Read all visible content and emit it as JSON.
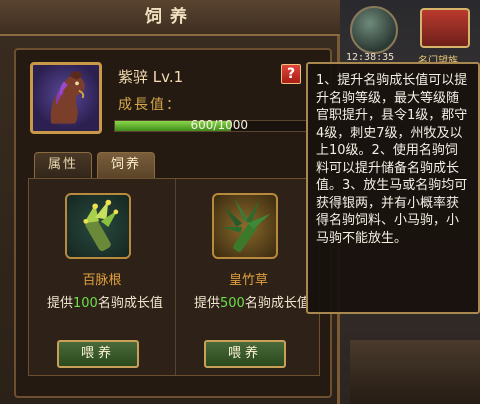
{
  "panel": {
    "title": "饲养"
  },
  "horse": {
    "name": "紫骍 Lv.1",
    "growth_label": "成長值：",
    "progress_current": 600,
    "progress_max": 1000,
    "progress_text": "600/1000",
    "progress_fraction": 0.6
  },
  "help_button": {
    "label": "?"
  },
  "tabs": [
    {
      "label": "属性"
    },
    {
      "label": "饲养"
    }
  ],
  "items": [
    {
      "name": "百脉根",
      "desc_prefix": "提供",
      "amount": "100",
      "desc_suffix": "名驹成长值",
      "button": "喂养",
      "icon": "grass-bundle-icon"
    },
    {
      "name": "皇竹草",
      "desc_prefix": "提供",
      "amount": "500",
      "desc_suffix": "名驹成长值",
      "button": "喂养",
      "icon": "bamboo-grass-icon"
    }
  ],
  "tooltip": {
    "text": "1、提升名驹成长值可以提升名驹等级，最大等级随官职提升，县令1级，郡守4级，刺史7级，州牧及以上10级。2、使用名驹饲料可以提升储备名驹成长值。3、放生马或名驹均可获得银两，并有小概率获得名驹饲料、小马驹，小马驹不能放生。"
  },
  "background": {
    "time_label": "12:38:35",
    "banner": "名门望族"
  },
  "colors": {
    "accent_gold": "#d4a84a",
    "progress_green": "#6ae04a",
    "help_red": "#c8281e"
  }
}
